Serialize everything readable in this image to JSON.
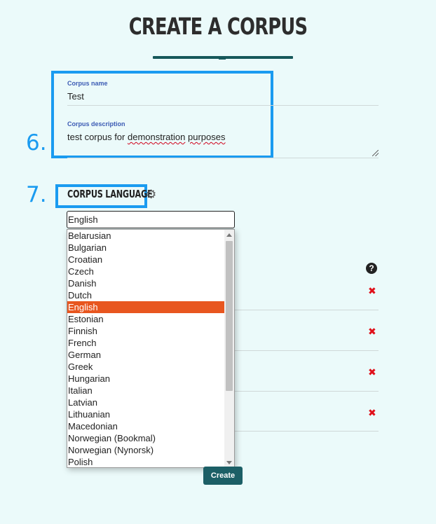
{
  "page": {
    "title": "CREATE A CORPUS"
  },
  "steps": {
    "step6": "6.",
    "step7": "7."
  },
  "form": {
    "name_label": "Corpus name",
    "name_value": "Test",
    "description_label": "Corpus description",
    "description_value_pre": "test corpus for ",
    "description_value_misspelled": "demonstration",
    "description_value_space": " ",
    "description_value_misspelled2": "purposes"
  },
  "language": {
    "heading": "CORPUS LANGUAGE",
    "selected": "English",
    "options": [
      "Belarusian",
      "Bulgarian",
      "Croatian",
      "Czech",
      "Danish",
      "Dutch",
      "English",
      "Estonian",
      "Finnish",
      "French",
      "German",
      "Greek",
      "Hungarian",
      "Italian",
      "Latvian",
      "Lithuanian",
      "Macedonian",
      "Norwegian (Bookmal)",
      "Norwegian (Nynorsk)",
      "Polish"
    ]
  },
  "icons": {
    "gear": "gear-icon",
    "help": "question-circle-icon",
    "remove": "red-x-icon"
  },
  "colors": {
    "background": "#ebfafa",
    "accent": "#1c5f66",
    "highlight": "#1a9bf0",
    "selected_option": "#e8561f",
    "remove": "#e0101a"
  },
  "help_glyph": "?",
  "remove_glyph": "✖",
  "buttons": {
    "create": "Create"
  }
}
